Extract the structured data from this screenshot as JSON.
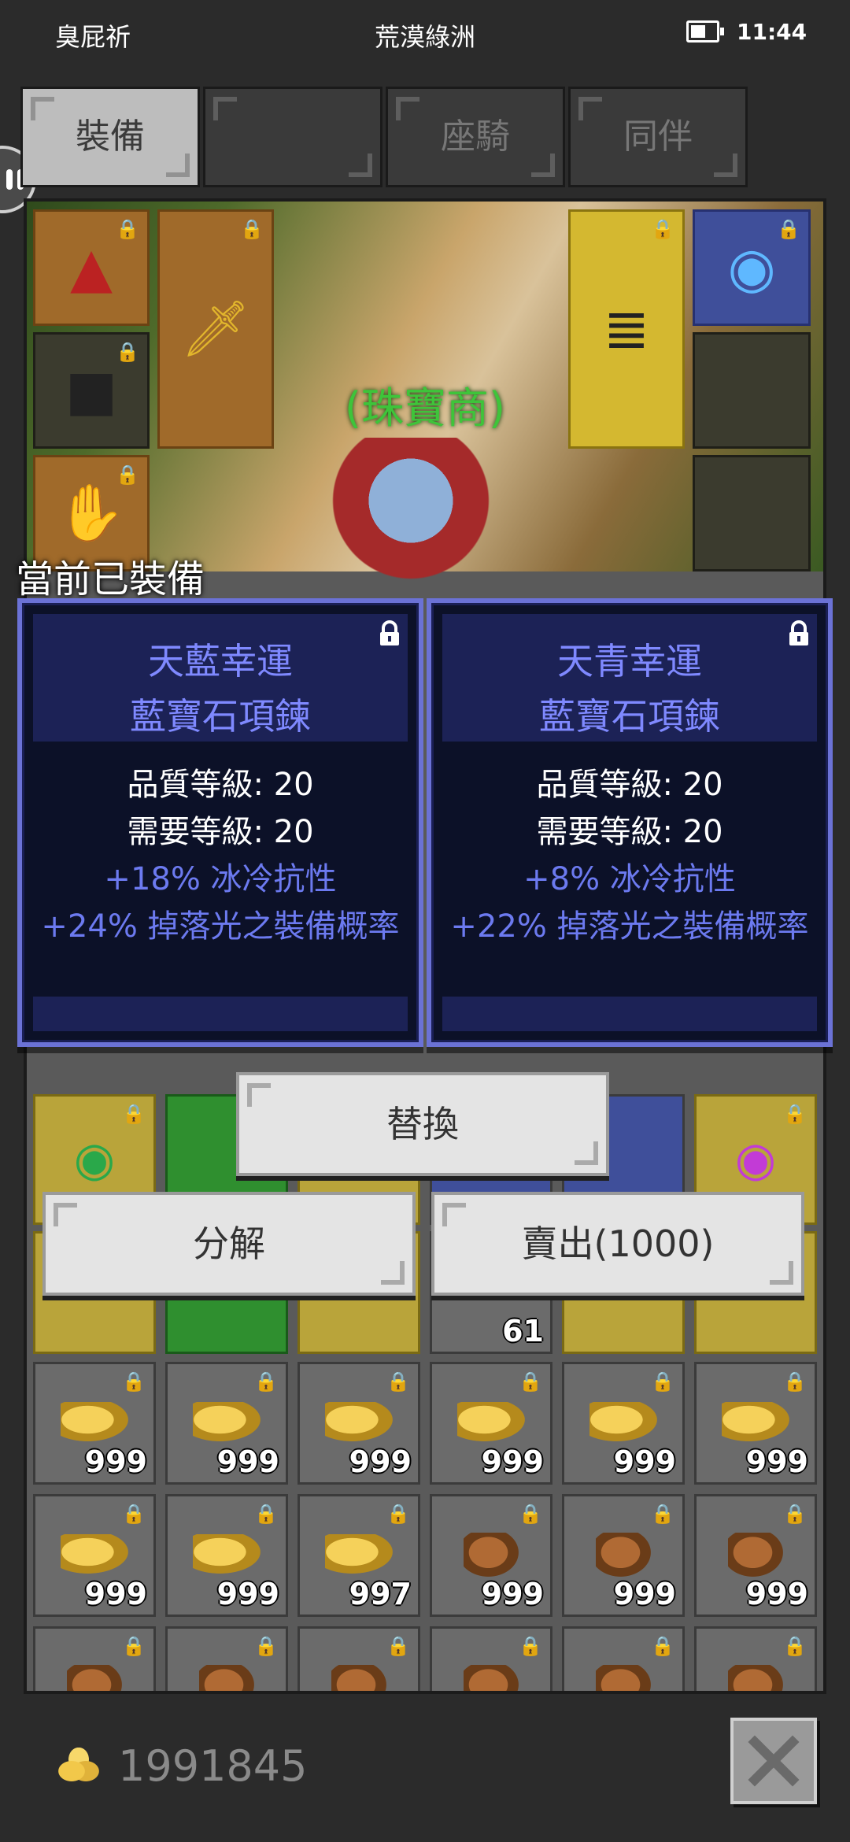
{
  "status_bar": {
    "left_text": "臭屁祈",
    "center_text": "荒漠綠洲",
    "battery_level": 0.5,
    "time": "11:44"
  },
  "tabs": [
    {
      "label": "裝備",
      "active": true
    },
    {
      "label": "",
      "active": false
    },
    {
      "label": "座騎",
      "active": false
    },
    {
      "label": "同伴",
      "active": false
    }
  ],
  "scene": {
    "npc_label": "(珠寶商)"
  },
  "equipped_label": "當前已裝備",
  "cards": [
    {
      "title1": "天藍幸運",
      "title2": "藍寶石項鍊",
      "quality": "品質等級: 20",
      "required": "需要等級: 20",
      "stat1": "+18% 冰冷抗性",
      "stat2": "+24% 掉落光之裝備概率",
      "locked": true
    },
    {
      "title1": "天青幸運",
      "title2": "藍寶石項鍊",
      "quality": "品質等級: 20",
      "required": "需要等級: 20",
      "stat1": "+8% 冰冷抗性",
      "stat2": "+22% 掉落光之裝備概率",
      "locked": true
    }
  ],
  "buttons": {
    "replace": "替換",
    "disassemble": "分解",
    "sell": "賣出(1000)"
  },
  "inventory": {
    "partial_qty": "61",
    "row1": [
      "999",
      "999",
      "999",
      "999",
      "999",
      "999"
    ],
    "row2": [
      "999",
      "999",
      "997",
      "999",
      "999",
      "999"
    ]
  },
  "currency": {
    "gold": "1991845"
  }
}
